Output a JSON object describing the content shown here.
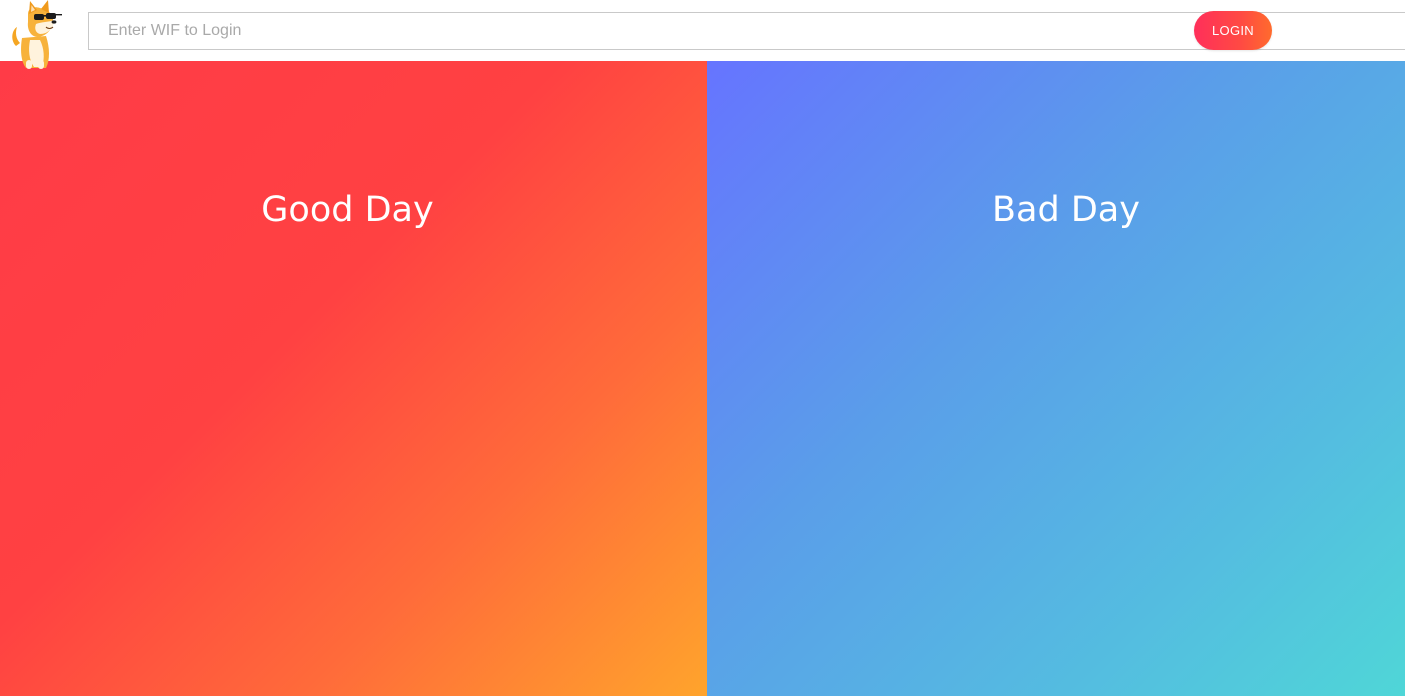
{
  "header": {
    "logo_icon": "shiba-dog-with-sunglasses-icon",
    "login_input": {
      "placeholder": "Enter WIF to Login",
      "value": ""
    },
    "login_button_label": "LOGIN"
  },
  "panels": {
    "good": {
      "title": "Good Day",
      "gradient": [
        "#ff3b47",
        "#ff4142",
        "#ff6b3a",
        "#ffa42c"
      ]
    },
    "bad": {
      "title": "Bad Day",
      "gradient": [
        "#6674ff",
        "#5a9ee9",
        "#54bde0",
        "#4fd6d7"
      ]
    }
  },
  "colors": {
    "login_button": "#ff3b4e",
    "text_on_panels": "#ffffff"
  }
}
